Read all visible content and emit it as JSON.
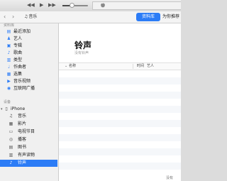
{
  "toolbar": {
    "prev_icon": "◀◀",
    "play_icon": "▶",
    "next_icon": "▶▶",
    "volume_level": 0.35,
    "lcd_icon": "apple-icon"
  },
  "nav": {
    "back_icon": "‹",
    "forward_icon": "›",
    "media_note": "♫",
    "media_label": "音乐",
    "library_button": "资料库",
    "for_you_button": "为你推荐"
  },
  "sidebar": {
    "library_heading": "资料库",
    "library_items": [
      {
        "label": "最近添加",
        "icon": "recently-added-icon",
        "glyph": "▤"
      },
      {
        "label": "艺人",
        "icon": "artist-icon",
        "glyph": "♟"
      },
      {
        "label": "专辑",
        "icon": "album-icon",
        "glyph": "▣"
      },
      {
        "label": "歌曲",
        "icon": "song-icon",
        "glyph": "♪"
      },
      {
        "label": "类型",
        "icon": "genre-icon",
        "glyph": "▥"
      },
      {
        "label": "作曲者",
        "icon": "composer-icon",
        "glyph": "♩"
      },
      {
        "label": "选集",
        "icon": "compilation-icon",
        "glyph": "▦"
      },
      {
        "label": "音乐视频",
        "icon": "music-video-icon",
        "glyph": "▶"
      },
      {
        "label": "互联网广播",
        "icon": "radio-icon",
        "glyph": "◉"
      }
    ],
    "devices_heading": "设备",
    "device": {
      "label": "iPhone",
      "icon": "iphone-icon",
      "glyph": "▯",
      "toggle": "▾"
    },
    "device_items": [
      {
        "label": "音乐",
        "icon": "music-icon",
        "glyph": "♫"
      },
      {
        "label": "影片",
        "icon": "movie-icon",
        "glyph": "▦"
      },
      {
        "label": "电视节目",
        "icon": "tv-icon",
        "glyph": "▭"
      },
      {
        "label": "播客",
        "icon": "podcast-icon",
        "glyph": "◎"
      },
      {
        "label": "图书",
        "icon": "book-icon",
        "glyph": "▤"
      },
      {
        "label": "有声读物",
        "icon": "audiobook-icon",
        "glyph": "▥"
      },
      {
        "label": "铃声",
        "icon": "ringtone-icon",
        "glyph": "♪",
        "selected": true
      }
    ]
  },
  "main": {
    "title": "铃声",
    "subtitle": "没有铃声",
    "columns": {
      "name": "名称",
      "time": "时间",
      "artist": "艺人"
    }
  },
  "status_text": "没有"
}
